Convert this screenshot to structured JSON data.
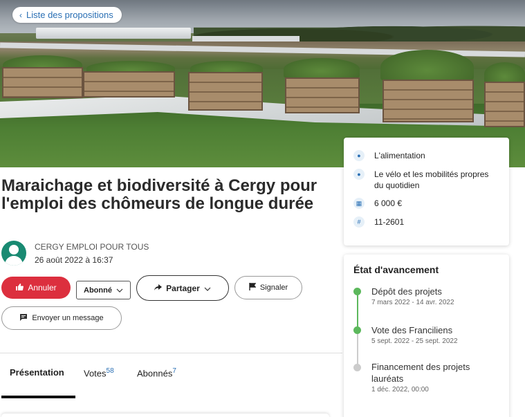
{
  "back_link": {
    "label": "Liste des propositions"
  },
  "project": {
    "title": "Maraichage et biodiversité à Cergy pour l'emploi des chômeurs de longue durée",
    "author": "CERGY EMPLOI POUR TOUS",
    "date": "26 août 2022 à 16:37"
  },
  "actions": {
    "cancel_label": "Annuler",
    "follow_label": "Abonné",
    "share_label": "Partager",
    "report_label": "Signaler",
    "message_label": "Envoyer un message"
  },
  "tabs": [
    {
      "label": "Présentation",
      "count": ""
    },
    {
      "label": "Votes",
      "count": "58"
    },
    {
      "label": "Abonnés",
      "count": "7"
    }
  ],
  "info": {
    "items": [
      {
        "icon": "tag-icon",
        "text": "L'alimentation"
      },
      {
        "icon": "tag-icon",
        "text": "Le vélo et les mobilités propres du quotidien"
      },
      {
        "icon": "budget-icon",
        "text": "6 000 €"
      },
      {
        "icon": "hash-icon",
        "text": "11-2601"
      }
    ]
  },
  "progress": {
    "title": "État d'avancement",
    "steps": [
      {
        "label": "Dépôt des projets",
        "date": "7 mars 2022 - 14 avr. 2022",
        "status": "done"
      },
      {
        "label": "Vote des Franciliens",
        "date": "5 sept. 2022 - 25 sept. 2022",
        "status": "done"
      },
      {
        "label": "Financement des projets lauréats",
        "date": "1 déc. 2022, 00:00",
        "status": "pending"
      }
    ]
  },
  "colors": {
    "accent": "#2a6fb4",
    "danger": "#dc2f3e",
    "done": "#5cb85c",
    "pending": "#cccccc"
  }
}
